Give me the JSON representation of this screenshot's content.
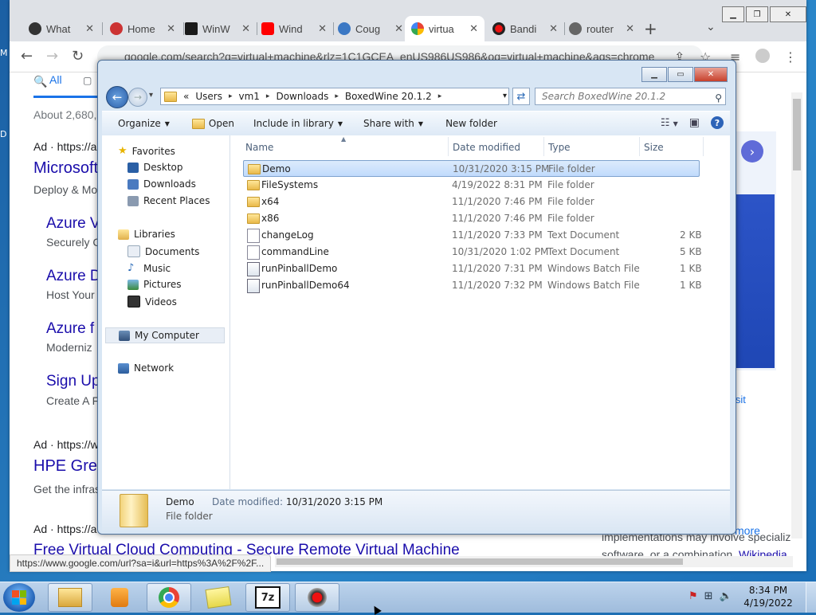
{
  "desktop_left_texts": [
    "M",
    "D"
  ],
  "chrome": {
    "tabs": [
      {
        "title": "What",
        "icon": "github-icon",
        "color": "#333333"
      },
      {
        "title": "Home",
        "icon": "community-icon",
        "color": "#cc3333"
      },
      {
        "title": "WinW",
        "icon": "w-logo-icon",
        "color": "#1a1a1a"
      },
      {
        "title": "Wind",
        "icon": "youtube-icon",
        "color": "#ff0000"
      },
      {
        "title": "Coug",
        "icon": "cougar-icon",
        "color": "#3b78c4"
      },
      {
        "title": "virtua",
        "icon": "google-icon",
        "color": "#4285f4",
        "active": true
      },
      {
        "title": "Bandi",
        "icon": "bandicam-icon",
        "color": "#222222"
      },
      {
        "title": "router",
        "icon": "globe-icon",
        "color": "#666666"
      }
    ],
    "new_tab": "+",
    "tab_dropdown": "⌄",
    "url": "google.com/search?q=virtual+machine&rlz=1C1GCEA_enUS986US986&oq=virtual+machine&aqs=chrome",
    "status_url": "https://www.google.com/url?sa=i&url=https%3A%2F%2F..."
  },
  "google": {
    "all_tab": "All",
    "about": "About 2,680,",
    "ads": [
      {
        "label": "Ad · https://a",
        "title": "Microsoft",
        "desc": "Deploy & Mo"
      },
      {
        "label": "Ad · https://w",
        "title": "HPE Gre",
        "desc": "Get the infras"
      },
      {
        "label": "Ad · https://a",
        "title": "",
        "desc": ""
      }
    ],
    "sublinks": [
      {
        "title": "Azure V",
        "desc": "Securely C"
      },
      {
        "title": "Azure D",
        "desc": "Host Your"
      },
      {
        "title": "Azure f",
        "desc": "Moderniz"
      },
      {
        "title": "Sign Up",
        "desc": "Create A F"
      }
    ],
    "bottom_title": "Free Virtual Cloud Computing - Secure Remote Virtual Machine",
    "right_panel": {
      "visit": "isit",
      "more": "more",
      "wiki_line1": "implementations may involve specializ",
      "wiki_line2_prefix": "software, or a combination.",
      "wiki_link": "Wikipedia"
    }
  },
  "explorer": {
    "breadcrumb": [
      "«",
      "Users",
      "vm1",
      "Downloads",
      "BoxedWine 20.1.2"
    ],
    "search_placeholder": "Search BoxedWine 20.1.2",
    "toolbar": {
      "organize": "Organize",
      "open": "Open",
      "include_in_library": "Include in library",
      "share_with": "Share with",
      "new_folder": "New folder"
    },
    "nav": {
      "favorites": "Favorites",
      "favorites_items": [
        "Desktop",
        "Downloads",
        "Recent Places"
      ],
      "libraries": "Libraries",
      "libraries_items": [
        "Documents",
        "Music",
        "Pictures",
        "Videos"
      ],
      "my_computer": "My Computer",
      "network": "Network"
    },
    "columns": {
      "name": "Name",
      "date": "Date modified",
      "type": "Type",
      "size": "Size"
    },
    "files": [
      {
        "name": "Demo",
        "date": "10/31/2020 3:15 PM",
        "type": "File folder",
        "size": "",
        "kind": "folder",
        "selected": true
      },
      {
        "name": "FileSystems",
        "date": "4/19/2022 8:31 PM",
        "type": "File folder",
        "size": "",
        "kind": "folder"
      },
      {
        "name": "x64",
        "date": "11/1/2020 7:46 PM",
        "type": "File folder",
        "size": "",
        "kind": "folder"
      },
      {
        "name": "x86",
        "date": "11/1/2020 7:46 PM",
        "type": "File folder",
        "size": "",
        "kind": "folder"
      },
      {
        "name": "changeLog",
        "date": "11/1/2020 7:33 PM",
        "type": "Text Document",
        "size": "2 KB",
        "kind": "text"
      },
      {
        "name": "commandLine",
        "date": "10/31/2020 1:02 PM",
        "type": "Text Document",
        "size": "5 KB",
        "kind": "text"
      },
      {
        "name": "runPinballDemo",
        "date": "11/1/2020 7:31 PM",
        "type": "Windows Batch File",
        "size": "1 KB",
        "kind": "batch"
      },
      {
        "name": "runPinballDemo64",
        "date": "11/1/2020 7:32 PM",
        "type": "Windows Batch File",
        "size": "1 KB",
        "kind": "batch"
      }
    ],
    "details": {
      "name": "Demo",
      "type": "File folder",
      "date_label": "Date modified:",
      "date_value": "10/31/2020 3:15 PM"
    }
  },
  "taskbar": {
    "items": [
      "explorer-icon",
      "media-player-icon",
      "chrome-icon",
      "folder-notes-icon",
      "7zip-icon",
      "bandicam-icon"
    ],
    "zip_label": "7z",
    "clock_time": "8:34 PM",
    "clock_date": "4/19/2022"
  }
}
